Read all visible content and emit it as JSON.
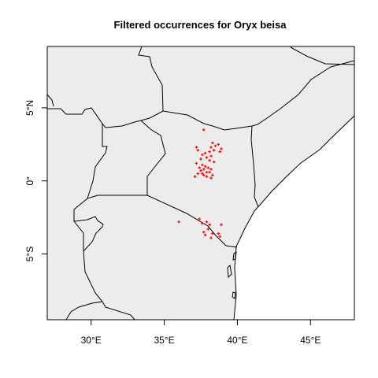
{
  "title": "Filtered occurrences for Oryx beisa",
  "x_tick_labels": [
    "30°E",
    "35°E",
    "40°E",
    "45°E"
  ],
  "y_tick_labels": [
    "5°N",
    "0°",
    "5°S"
  ],
  "colors": {
    "land": "#ececec",
    "sea": "#ffffff",
    "border": "#000000",
    "points": "#ff0000"
  },
  "map_data": {
    "type": "scatter-map",
    "xlim": [
      27,
      48
    ],
    "ylim": [
      -9.5,
      9.2
    ],
    "x_ticks": [
      30,
      35,
      40,
      45
    ],
    "y_ticks": [
      5,
      0,
      -5
    ],
    "points": [
      [
        37.7,
        3.5
      ],
      [
        38.3,
        2.6
      ],
      [
        38.5,
        2.4
      ],
      [
        38.7,
        2.5
      ],
      [
        38.2,
        2.3
      ],
      [
        37.2,
        2.3
      ],
      [
        37.3,
        2.1
      ],
      [
        38.9,
        2.2
      ],
      [
        38.8,
        2.0
      ],
      [
        38.4,
        2.1
      ],
      [
        38.1,
        2.0
      ],
      [
        37.8,
        1.9
      ],
      [
        37.6,
        1.8
      ],
      [
        38.2,
        1.7
      ],
      [
        37.9,
        1.6
      ],
      [
        37.5,
        1.5
      ],
      [
        38.1,
        1.4
      ],
      [
        38.4,
        1.3
      ],
      [
        37.2,
        1.2
      ],
      [
        37.6,
        1.1
      ],
      [
        37.8,
        1.0
      ],
      [
        38.0,
        0.9
      ],
      [
        37.4,
        0.9
      ],
      [
        37.7,
        0.8
      ],
      [
        38.2,
        0.8
      ],
      [
        37.5,
        0.7
      ],
      [
        37.9,
        0.6
      ],
      [
        38.1,
        0.6
      ],
      [
        37.3,
        0.5
      ],
      [
        37.6,
        0.5
      ],
      [
        38.3,
        0.4
      ],
      [
        37.9,
        0.3
      ],
      [
        38.2,
        0.2
      ],
      [
        37.7,
        0.4
      ],
      [
        37.1,
        0.3
      ],
      [
        36.0,
        -2.8
      ],
      [
        37.4,
        -2.6
      ],
      [
        37.6,
        -2.9
      ],
      [
        37.9,
        -2.8
      ],
      [
        38.1,
        -3.0
      ],
      [
        38.0,
        -3.3
      ],
      [
        37.7,
        -3.5
      ],
      [
        38.3,
        -3.6
      ],
      [
        38.9,
        -3.0
      ],
      [
        38.7,
        -3.6
      ],
      [
        38.8,
        -3.8
      ],
      [
        38.2,
        -3.9
      ],
      [
        37.8,
        -3.7
      ]
    ]
  }
}
